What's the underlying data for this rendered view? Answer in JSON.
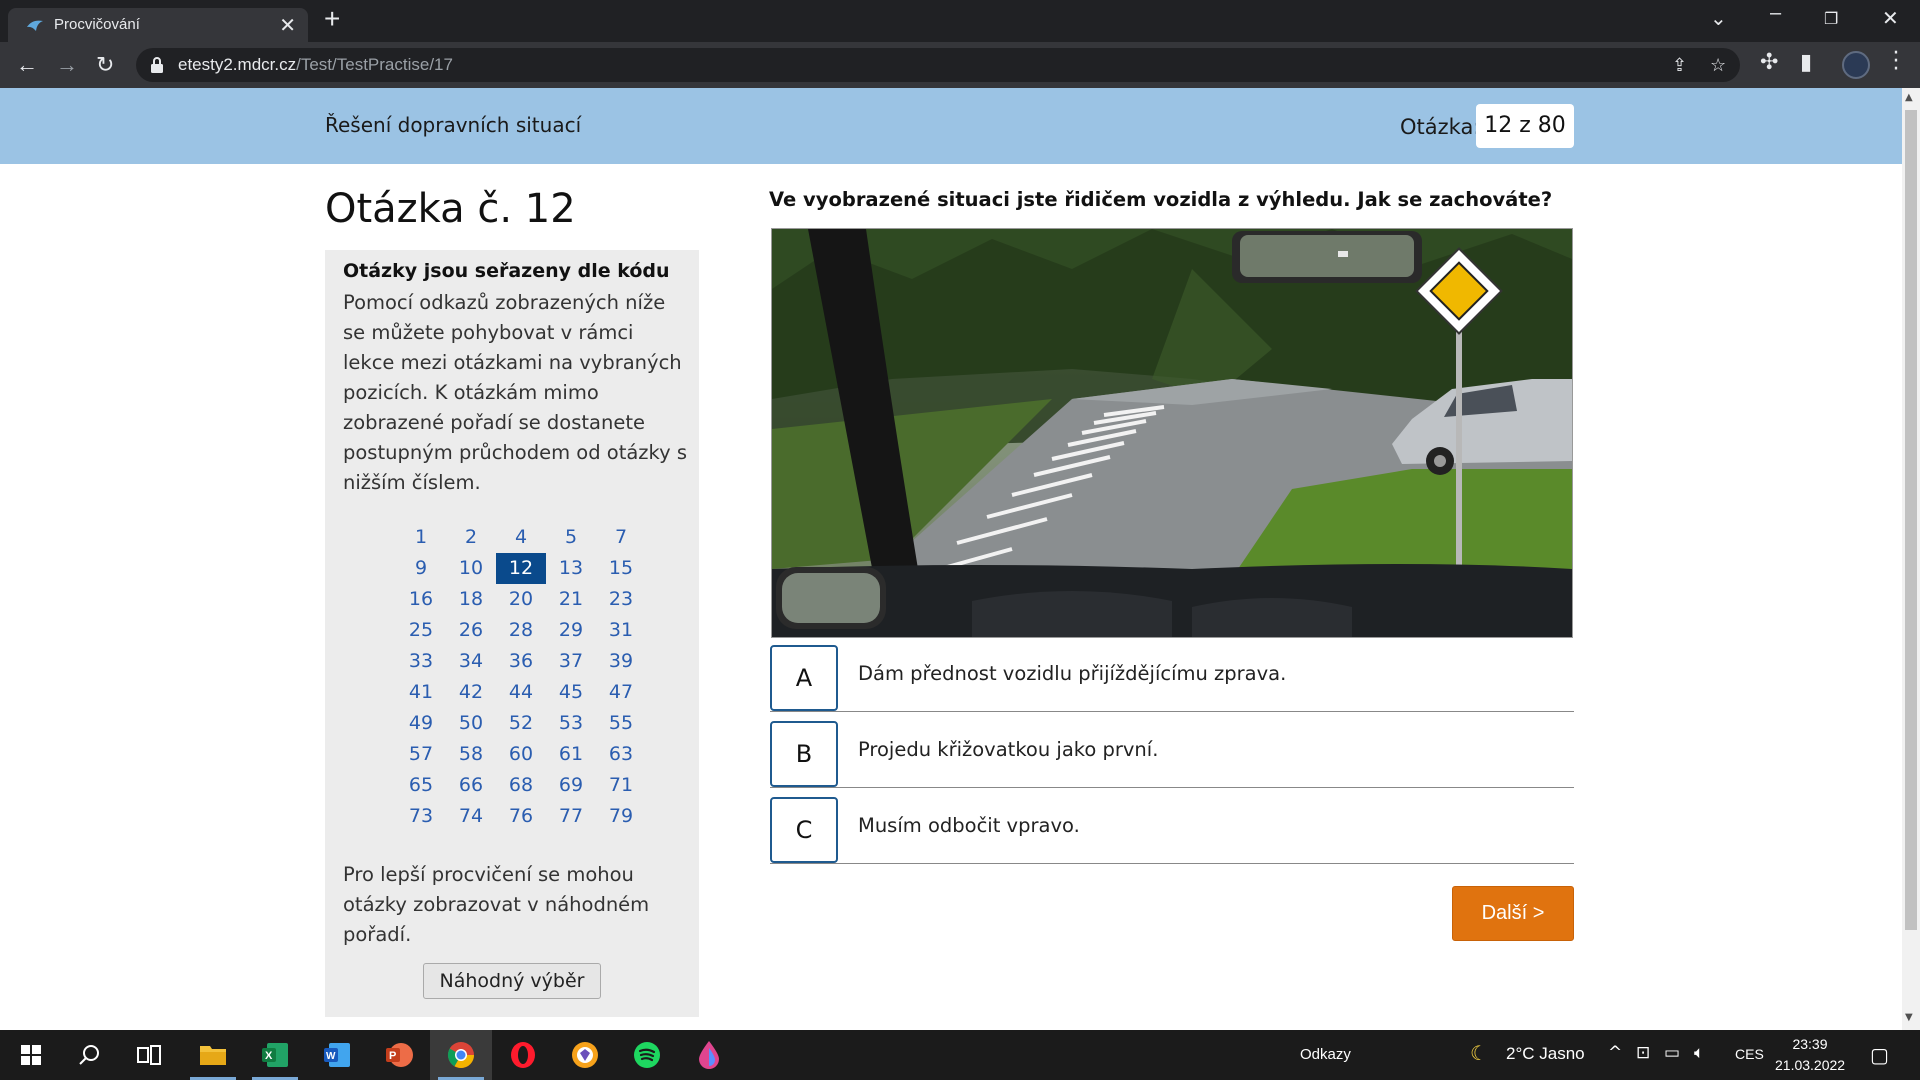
{
  "browser": {
    "tab_title": "Procvičování",
    "tab_close": "✕",
    "new_tab": "+",
    "url_host": "etesty2.mdcr.cz",
    "url_path": "/Test/TestPractise/17"
  },
  "banner": {
    "section_title": "Řešení dopravních situací",
    "question_label": "Otázka:",
    "question_counter": "12 z 80"
  },
  "heading": "Otázka č. 12",
  "sidebar": {
    "info_title": "Otázky jsou seřazeny dle kódu",
    "info_text": "Pomocí odkazů zobrazených níže se můžete pohybovat v rámci lekce mezi otázkami na vybraných pozicích. K otázkám mimo zobrazené pořadí se dostanete postupným průchodem od otázky s nižším číslem.",
    "numbers": [
      "1",
      "2",
      "4",
      "5",
      "7",
      "9",
      "10",
      "12",
      "13",
      "15",
      "16",
      "18",
      "20",
      "21",
      "23",
      "25",
      "26",
      "28",
      "29",
      "31",
      "33",
      "34",
      "36",
      "37",
      "39",
      "41",
      "42",
      "44",
      "45",
      "47",
      "49",
      "50",
      "52",
      "53",
      "55",
      "57",
      "58",
      "60",
      "61",
      "63",
      "65",
      "66",
      "68",
      "69",
      "71",
      "73",
      "74",
      "76",
      "77",
      "79"
    ],
    "current": "12",
    "random_text": "Pro lepší procvičení se mohou otázky zobrazovat v náhodném pořadí.",
    "random_button": "Náhodný výběr"
  },
  "question": {
    "text": "Ve vyobrazené situaci jste řidičem vozidla z výhledu. Jak se zachováte?",
    "answers": [
      {
        "letter": "A",
        "text": "Dám přednost vozidlu přijíždějícímu zprava."
      },
      {
        "letter": "B",
        "text": "Projedu křižovatkou jako první."
      },
      {
        "letter": "C",
        "text": "Musím odbočit vpravo."
      }
    ],
    "next_button": "Další >"
  },
  "taskbar": {
    "links_label": "Odkazy",
    "weather": "2°C  Jasno",
    "lang": "CES",
    "time": "23:39",
    "date": "21.03.2022"
  },
  "colors": {
    "banner": "#9bc3e4",
    "accent_orange": "#e0730f",
    "link_blue": "#2a5db0",
    "active_number": "#0a4a8c"
  }
}
